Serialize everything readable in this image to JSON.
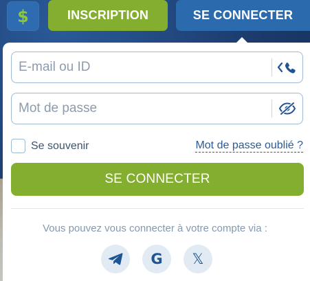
{
  "header": {
    "currency_symbol": "$",
    "register_label": "INSCRIPTION",
    "login_label": "SE CONNECTER"
  },
  "login_form": {
    "email_placeholder": "E-mail ou ID",
    "email_value": "",
    "email_toggle_icon": "phone-switch-icon",
    "password_placeholder": "Mot de passe",
    "password_value": "",
    "password_toggle_icon": "eye-slash-icon",
    "remember_label": "Se souvenir",
    "remember_checked": false,
    "forgot_label": "Mot de passe oublié ?",
    "submit_label": "SE CONNECTER"
  },
  "social": {
    "text": "Vous pouvez vous connecter à votre compte via :",
    "providers": [
      {
        "icon": "telegram-icon"
      },
      {
        "icon": "google-icon",
        "glyph": "G"
      },
      {
        "icon": "x-icon",
        "glyph": "𝕏"
      }
    ]
  },
  "colors": {
    "primary_green": "#84ae2f",
    "primary_blue": "#2c6aae",
    "link_blue": "#2a5a94",
    "currency_green": "#8dc63f"
  }
}
